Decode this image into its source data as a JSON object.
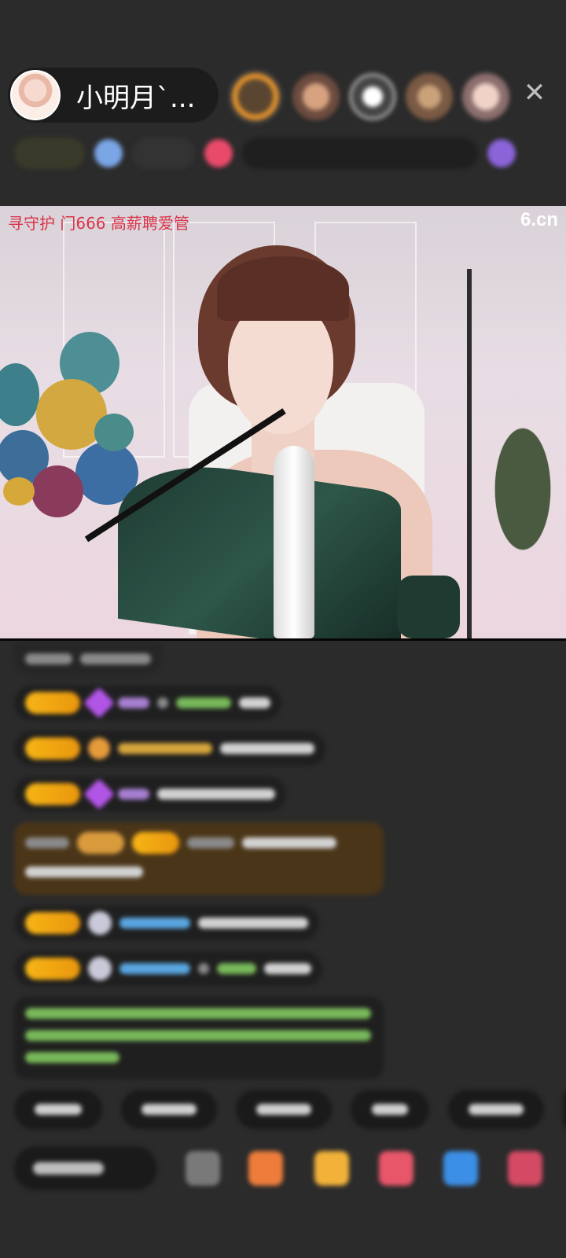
{
  "host": {
    "name": "小明月`...",
    "avatar_icon": "host-avatar"
  },
  "top_bar": {
    "close_icon": "✕",
    "viewer_count": 5
  },
  "video": {
    "banner_text": "寻守护 门666 高薪聘爱管",
    "watermark": "6.cn"
  },
  "chat": {
    "message_count": 10
  },
  "quick_replies": {
    "count": 6
  },
  "bottom_bar": {
    "icons": [
      "emoji-icon",
      "gift-box-icon",
      "gift-bag-icon",
      "heart-icon",
      "game-icon",
      "more-icon"
    ]
  },
  "colors": {
    "background": "#2b2b2b",
    "badge_gold": "#f7b516",
    "banner_red": "#d9334a"
  }
}
